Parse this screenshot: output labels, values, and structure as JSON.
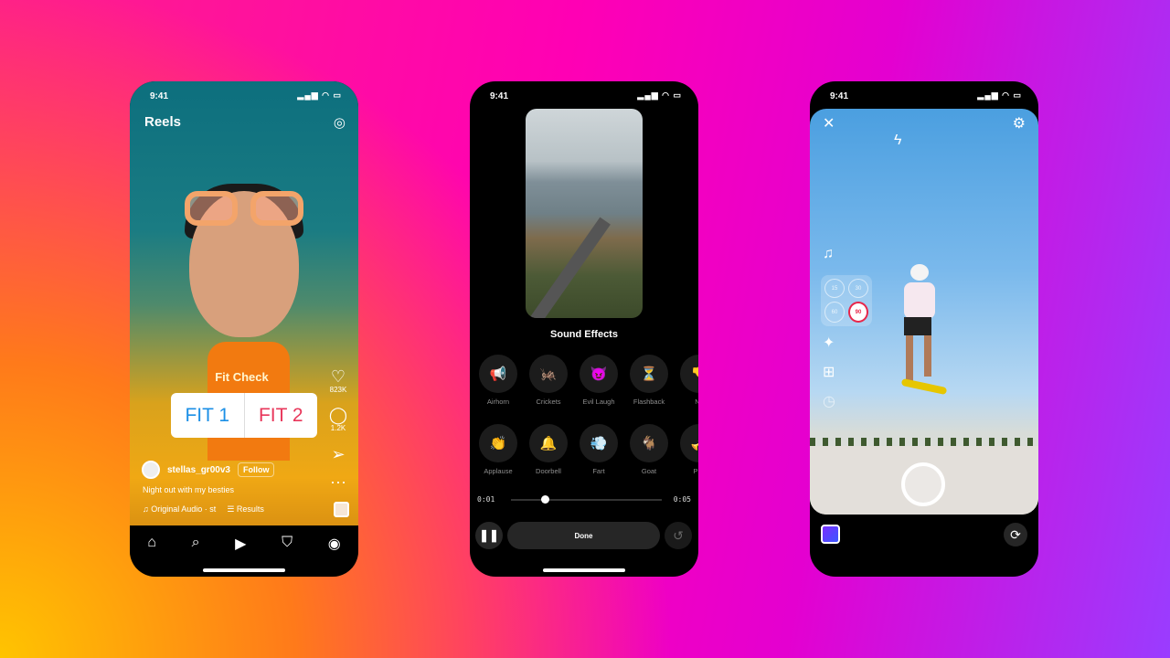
{
  "status_time": "9:41",
  "status_icons": "▂▄▆ ◠ ▭",
  "reels": {
    "title": "Reels",
    "camera_icon": "camera-icon",
    "sticker_title": "Fit Check",
    "poll_options": [
      "FIT 1",
      "FIT 2"
    ],
    "poll_colors": [
      "#1b8fe6",
      "#e8365a"
    ],
    "likes": "823K",
    "comments": "1.2K",
    "username": "stellas_gr00v3",
    "follow_label": "Follow",
    "caption": "Night out with my besties",
    "audio": "Original Audio · st",
    "results_label": "Results",
    "nav": [
      "home-icon",
      "search-icon",
      "reels-icon",
      "shop-icon",
      "profile-icon"
    ]
  },
  "sound_effects": {
    "title": "Sound Effects",
    "row1": [
      {
        "label": "Airhorn",
        "emoji": "📢"
      },
      {
        "label": "Crickets",
        "emoji": "🦗"
      },
      {
        "label": "Evil Laugh",
        "emoji": "😈"
      },
      {
        "label": "Flashback",
        "emoji": "⏳"
      },
      {
        "label": "No",
        "emoji": "👎"
      }
    ],
    "row2": [
      {
        "label": "Applause",
        "emoji": "👏"
      },
      {
        "label": "Doorbell",
        "emoji": "🔔"
      },
      {
        "label": "Fart",
        "emoji": "💨"
      },
      {
        "label": "Goat",
        "emoji": "🐐"
      },
      {
        "label": "Plot",
        "emoji": "🎺"
      }
    ],
    "time_current": "0:01",
    "time_total": "0:05",
    "progress": 0.2,
    "done_label": "Done"
  },
  "camera": {
    "timers": [
      "15",
      "30",
      "60",
      "90"
    ],
    "selected_timer": "90",
    "accent": "#e8264a"
  }
}
